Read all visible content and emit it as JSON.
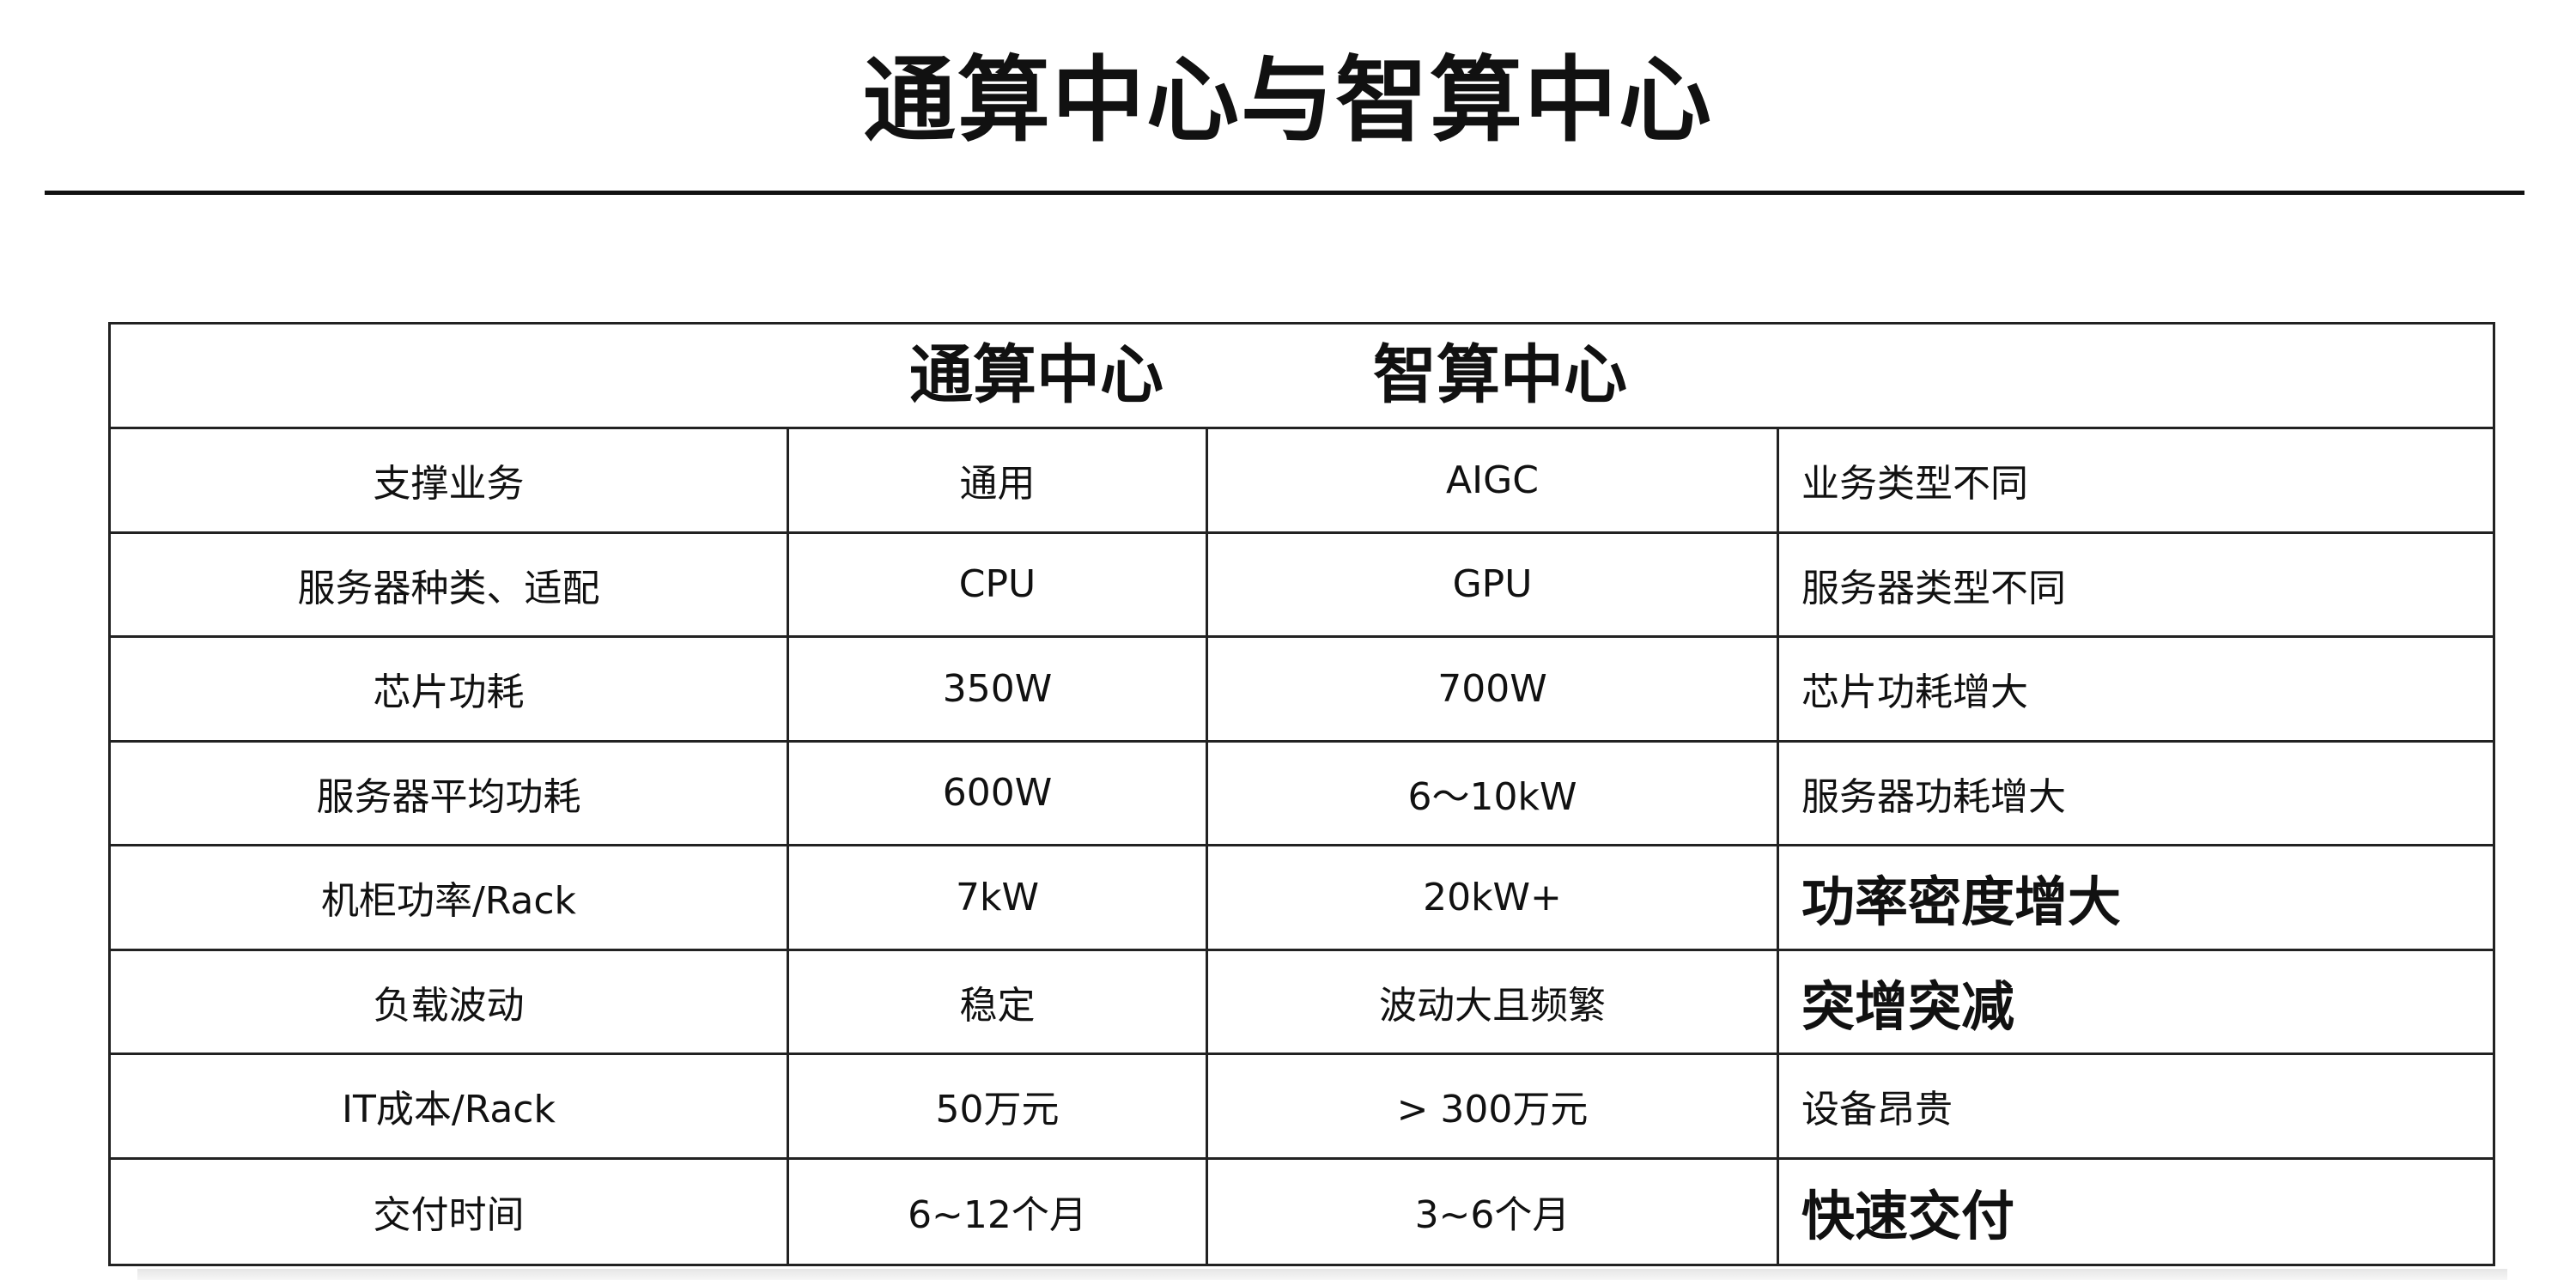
{
  "page": {
    "title": "通算中心与智算中心"
  },
  "table": {
    "header": {
      "general": "通算中心",
      "intelligent": "智算中心"
    },
    "rows": [
      {
        "item": "支撑业务",
        "general": "通用",
        "intelligent": "AIGC",
        "difference": "业务类型不同",
        "emphasis": false
      },
      {
        "item": "服务器种类、适配",
        "general": "CPU",
        "intelligent": "GPU",
        "difference": "服务器类型不同",
        "emphasis": false
      },
      {
        "item": "芯片功耗",
        "general": "350W",
        "intelligent": "700W",
        "difference": "芯片功耗增大",
        "emphasis": false
      },
      {
        "item": "服务器平均功耗",
        "general": "600W",
        "intelligent": "6～10kW",
        "difference": "服务器功耗增大",
        "emphasis": false
      },
      {
        "item": "机柜功率/Rack",
        "general": "7kW",
        "intelligent": "20kW+",
        "difference": "功率密度增大",
        "emphasis": true
      },
      {
        "item": "负载波动",
        "general": "稳定",
        "intelligent": "波动大且频繁",
        "difference": "突增突减",
        "emphasis": true
      },
      {
        "item": "IT成本/Rack",
        "general": "50万元",
        "intelligent": "> 300万元",
        "difference": "设备昂贵",
        "emphasis": false
      },
      {
        "item": "交付时间",
        "general": "6~12个月",
        "intelligent": "3~6个月",
        "difference": "快速交付",
        "emphasis": true
      }
    ]
  }
}
